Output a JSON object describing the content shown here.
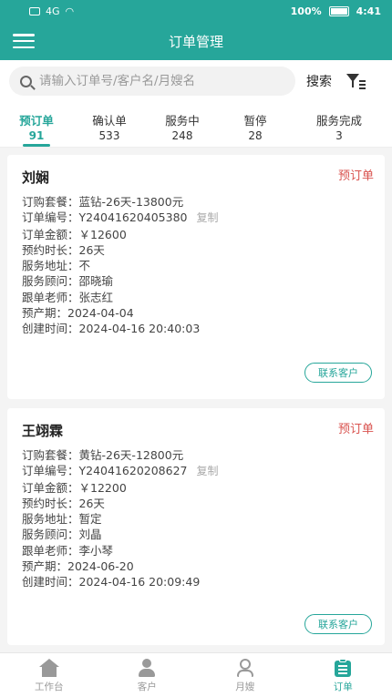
{
  "status_bar": {
    "network": "4G",
    "battery": "100%",
    "time": "4:41"
  },
  "header": {
    "title": "订单管理"
  },
  "search": {
    "placeholder": "请输入订单号/客户名/月嫂名",
    "button_label": "搜索"
  },
  "tabs": [
    {
      "label": "预订单",
      "count": "91"
    },
    {
      "label": "确认单",
      "count": "533"
    },
    {
      "label": "服务中",
      "count": "248"
    },
    {
      "label": "暂停",
      "count": "28"
    },
    {
      "label": "服务完成",
      "count": "3"
    }
  ],
  "orders": [
    {
      "customer": "刘娴",
      "status": "预订单",
      "fields": [
        {
          "key": "订购套餐：",
          "value": "蓝钻-26天-13800元"
        },
        {
          "key": "订单编号：",
          "value": "Y24041620405380"
        },
        {
          "key": "订单金额：",
          "value": "￥12600"
        },
        {
          "key": "预约时长：",
          "value": "26天"
        },
        {
          "key": "服务地址：",
          "value": "不"
        },
        {
          "key": "服务顾问：",
          "value": "邵晓瑜"
        },
        {
          "key": "跟单老师：",
          "value": "张志红"
        },
        {
          "key": "预产期：",
          "value": "2024-04-04"
        },
        {
          "key": "创建时间：",
          "value": "2024-04-16 20:40:03"
        }
      ],
      "copy_label": "复制",
      "contact_label": "联系客户"
    },
    {
      "customer": "王翊霖",
      "status": "预订单",
      "fields": [
        {
          "key": "订购套餐：",
          "value": "黄钻-26天-12800元"
        },
        {
          "key": "订单编号：",
          "value": "Y24041620208627"
        },
        {
          "key": "订单金额：",
          "value": "￥12200"
        },
        {
          "key": "预约时长：",
          "value": "26天"
        },
        {
          "key": "服务地址：",
          "value": "暂定"
        },
        {
          "key": "服务顾问：",
          "value": "刘晶"
        },
        {
          "key": "跟单老师：",
          "value": "李小琴"
        },
        {
          "key": "预产期：",
          "value": "2024-06-20"
        },
        {
          "key": "创建时间：",
          "value": "2024-04-16 20:09:49"
        }
      ],
      "copy_label": "复制",
      "contact_label": "联系客户"
    }
  ],
  "bottom_nav": [
    {
      "label": "工作台",
      "icon": "home-icon"
    },
    {
      "label": "客户",
      "icon": "user-icon"
    },
    {
      "label": "月嫂",
      "icon": "nanny-icon"
    },
    {
      "label": "订单",
      "icon": "order-icon"
    }
  ],
  "colors": {
    "primary": "#26a69a",
    "status_badge": "#d9534f"
  }
}
